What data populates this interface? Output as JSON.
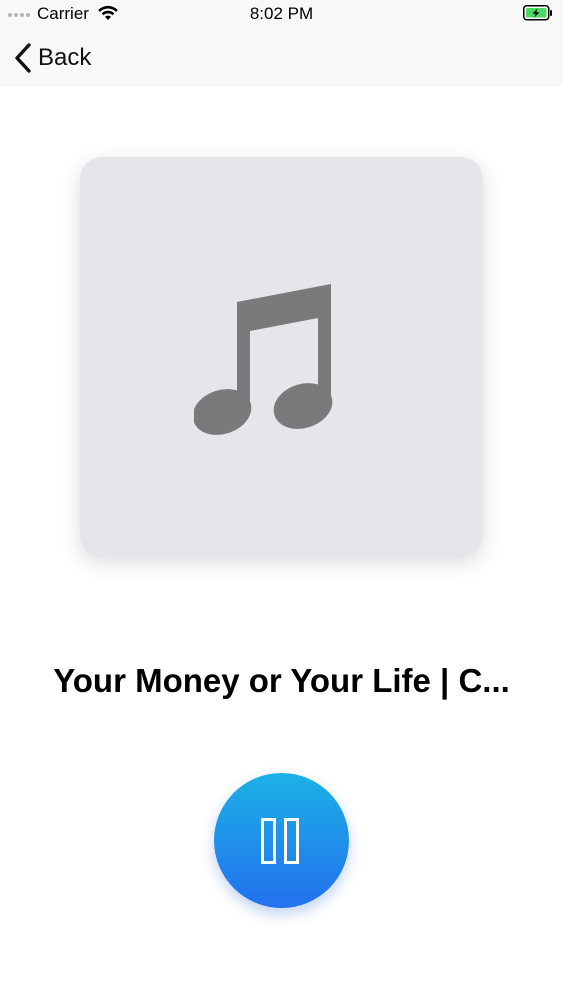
{
  "status_bar": {
    "carrier": "Carrier",
    "time": "8:02 PM",
    "icons": [
      "signal-dots-icon",
      "wifi-icon",
      "battery-charging-icon"
    ],
    "battery_color": "#4cd964"
  },
  "nav": {
    "back_label": "Back",
    "back_icon": "chevron-left-icon"
  },
  "artwork": {
    "icon": "music-note-icon",
    "background_color": "#e6e5e9",
    "icon_color": "#7a7a7c"
  },
  "track": {
    "title": "Your Money or Your Life | C..."
  },
  "controls": {
    "pause_icon": "pause-icon",
    "gradient_top": "#1bb2e6",
    "gradient_bottom": "#2370ee"
  }
}
